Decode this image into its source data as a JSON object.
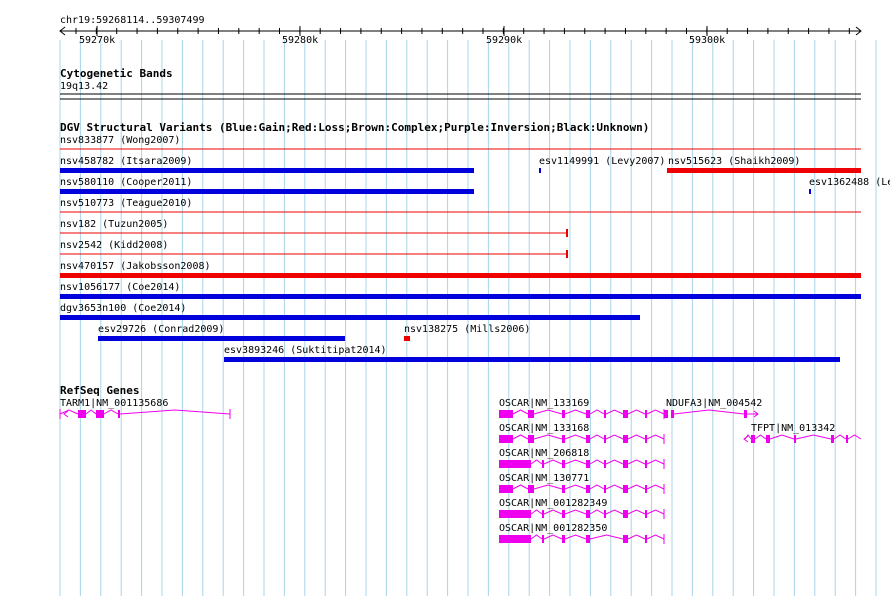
{
  "ruler": {
    "coordinate_label": "chr19:59268114..59307499",
    "tick_labels": [
      "59270k",
      "59280k",
      "59290k",
      "59300k"
    ]
  },
  "cytogenetic": {
    "title": "Cytogenetic Bands",
    "band_label": "19q13.42"
  },
  "dgv": {
    "title": "DGV Structural Variants (Blue:Gain;Red:Loss;Brown:Complex;Purple:Inversion;Black:Unknown)",
    "colors": {
      "gain": "#0000dd",
      "loss": "#ee0000"
    },
    "variants": [
      {
        "label": "nsv833877 (Wong2007)",
        "type": "loss",
        "style": "thin"
      },
      {
        "label": "nsv458782 (Itsara2009)",
        "type": "gain",
        "style": "thick"
      },
      {
        "label": "esv1149991 (Levy2007)",
        "type": "gain",
        "style": "thick"
      },
      {
        "label": "nsv515623 (Shaikh2009)",
        "type": "loss",
        "style": "thick"
      },
      {
        "label": "nsv580110 (Cooper2011)",
        "type": "gain",
        "style": "thick"
      },
      {
        "label": "esv1362488 (Le",
        "type": "gain",
        "style": "thick"
      },
      {
        "label": "nsv510773 (Teague2010)",
        "type": "loss",
        "style": "thin"
      },
      {
        "label": "nsv182 (Tuzun2005)",
        "type": "loss",
        "style": "thin"
      },
      {
        "label": "nsv2542 (Kidd2008)",
        "type": "loss",
        "style": "thin"
      },
      {
        "label": "nsv470157 (Jakobsson2008)",
        "type": "loss",
        "style": "thick"
      },
      {
        "label": "nsv1056177 (Coe2014)",
        "type": "gain",
        "style": "thick"
      },
      {
        "label": "dgv3653n100 (Coe2014)",
        "type": "gain",
        "style": "thick"
      },
      {
        "label": "esv29726 (Conrad2009)",
        "type": "gain",
        "style": "thick"
      },
      {
        "label": "nsv138275 (Mills2006)",
        "type": "loss",
        "style": "thick"
      },
      {
        "label": "esv3893246 (Suktitipat2014)",
        "type": "gain",
        "style": "thick"
      }
    ]
  },
  "refseq": {
    "title": "RefSeq Genes",
    "color": "#ee00ee",
    "genes": [
      {
        "label": "TARM1|NM_001135686"
      },
      {
        "label": "OSCAR|NM_133169"
      },
      {
        "label": "NDUFA3|NM_004542"
      },
      {
        "label": "OSCAR|NM_133168"
      },
      {
        "label": "TFPT|NM_013342"
      },
      {
        "label": "OSCAR|NM_206818"
      },
      {
        "label": "OSCAR|NM_130771"
      },
      {
        "label": "OSCAR|NM_001282349"
      },
      {
        "label": "OSCAR|NM_001282350"
      }
    ]
  }
}
